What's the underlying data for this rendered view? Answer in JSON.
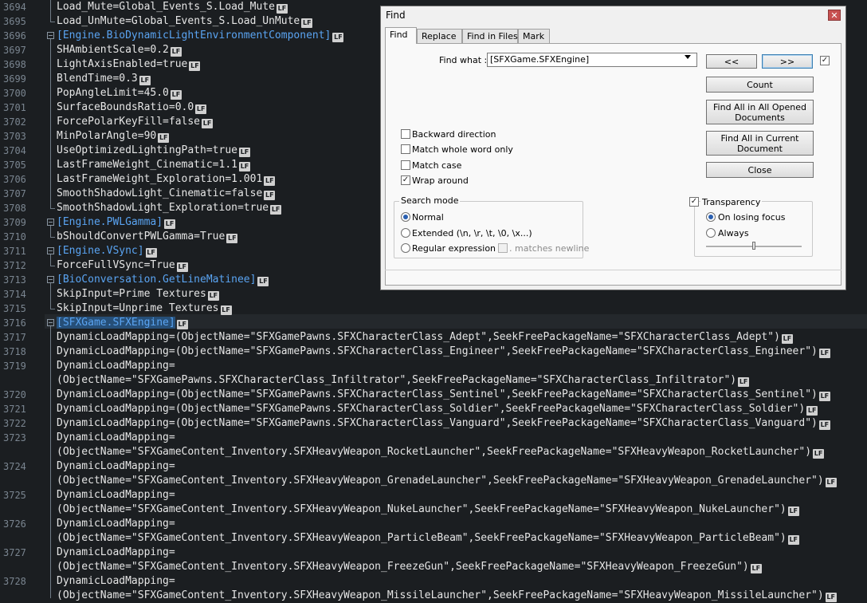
{
  "editor": {
    "lines": [
      {
        "n": "3694",
        "segs": [
          {
            "t": "Load_Mute",
            "c": "val"
          },
          {
            "t": "=",
            "c": "val"
          },
          {
            "t": "Global_Events_S.Load_Mute",
            "c": "val"
          }
        ],
        "lf": true
      },
      {
        "n": "3695",
        "segs": [
          {
            "t": "Load_UnMute",
            "c": "val"
          },
          {
            "t": "=",
            "c": "val"
          },
          {
            "t": "Global_Events_S.Load_UnMute",
            "c": "val"
          }
        ],
        "lf": true
      },
      {
        "n": "3696",
        "segs": [
          {
            "t": "[Engine.BioDynamicLightEnvironmentComponent]",
            "c": "sec"
          }
        ],
        "lf": true
      },
      {
        "n": "3697",
        "segs": [
          {
            "t": "SHAmbientScale=0.2",
            "c": "val"
          }
        ],
        "lf": true
      },
      {
        "n": "3698",
        "segs": [
          {
            "t": "LightAxisEnabled=true",
            "c": "val"
          }
        ],
        "lf": true
      },
      {
        "n": "3699",
        "segs": [
          {
            "t": "BlendTime=0.3",
            "c": "val"
          }
        ],
        "lf": true
      },
      {
        "n": "3700",
        "segs": [
          {
            "t": "PopAngleLimit=45.0",
            "c": "val"
          }
        ],
        "lf": true
      },
      {
        "n": "3701",
        "segs": [
          {
            "t": "SurfaceBoundsRatio=0.0",
            "c": "val"
          }
        ],
        "lf": true
      },
      {
        "n": "3702",
        "segs": [
          {
            "t": "ForcePolarKeyFill=false",
            "c": "val"
          }
        ],
        "lf": true
      },
      {
        "n": "3703",
        "segs": [
          {
            "t": "MinPolarAngle=90",
            "c": "val"
          }
        ],
        "lf": true
      },
      {
        "n": "3704",
        "segs": [
          {
            "t": "UseOptimizedLightingPath=true",
            "c": "val"
          }
        ],
        "lf": true
      },
      {
        "n": "3705",
        "segs": [
          {
            "t": "LastFrameWeight_Cinematic=1.1",
            "c": "val"
          }
        ],
        "lf": true
      },
      {
        "n": "3706",
        "segs": [
          {
            "t": "LastFrameWeight_Exploration=1.001",
            "c": "val"
          }
        ],
        "lf": true
      },
      {
        "n": "3707",
        "segs": [
          {
            "t": "SmoothShadowLight_Cinematic=false",
            "c": "val"
          }
        ],
        "lf": true
      },
      {
        "n": "3708",
        "segs": [
          {
            "t": "SmoothShadowLight_Exploration=true",
            "c": "val"
          }
        ],
        "lf": true
      },
      {
        "n": "3709",
        "segs": [
          {
            "t": "[Engine.PWLGamma]",
            "c": "sec"
          }
        ],
        "lf": true
      },
      {
        "n": "3710",
        "segs": [
          {
            "t": "bShouldConvertPWLGamma=True",
            "c": "val"
          }
        ],
        "lf": true
      },
      {
        "n": "3711",
        "segs": [
          {
            "t": "[Engine.VSync]",
            "c": "sec"
          }
        ],
        "lf": true
      },
      {
        "n": "3712",
        "segs": [
          {
            "t": "ForceFullVSync=True",
            "c": "val"
          }
        ],
        "lf": true
      },
      {
        "n": "3713",
        "segs": [
          {
            "t": "[BioConversation.GetLineMatinee]",
            "c": "sec"
          }
        ],
        "lf": true
      },
      {
        "n": "3714",
        "segs": [
          {
            "t": "SkipInput=Prime Textures",
            "c": "val"
          }
        ],
        "lf": true
      },
      {
        "n": "3715",
        "segs": [
          {
            "t": "SkipInput=Unprime Textures",
            "c": "val"
          }
        ],
        "lf": true
      },
      {
        "n": "3716",
        "segs": [
          {
            "t": "[SFXGame.SFXEngine]",
            "c": "sel"
          }
        ],
        "lf": true
      },
      {
        "n": "3717",
        "segs": [
          {
            "t": "DynamicLoadMapping=(ObjectName=\"SFXGamePawns.SFXCharacterClass_Adept\",SeekFreePackageName=\"SFXCharacterClass_Adept\")",
            "c": "val"
          }
        ],
        "lf": true
      },
      {
        "n": "3718",
        "segs": [
          {
            "t": "DynamicLoadMapping=(ObjectName=\"SFXGamePawns.SFXCharacterClass_Engineer\",SeekFreePackageName=\"SFXCharacterClass_Engineer\")",
            "c": "val"
          }
        ],
        "lf": true
      },
      {
        "n": "3719",
        "segs": [
          {
            "t": "DynamicLoadMapping=",
            "c": "val"
          }
        ],
        "lf": false
      },
      {
        "n": "",
        "segs": [
          {
            "t": "(ObjectName=\"SFXGamePawns.SFXCharacterClass_Infiltrator\",SeekFreePackageName=\"SFXCharacterClass_Infiltrator\")",
            "c": "val"
          }
        ],
        "lf": true
      },
      {
        "n": "3720",
        "segs": [
          {
            "t": "DynamicLoadMapping=(ObjectName=\"SFXGamePawns.SFXCharacterClass_Sentinel\",SeekFreePackageName=\"SFXCharacterClass_Sentinel\")",
            "c": "val"
          }
        ],
        "lf": true
      },
      {
        "n": "3721",
        "segs": [
          {
            "t": "DynamicLoadMapping=(ObjectName=\"SFXGamePawns.SFXCharacterClass_Soldier\",SeekFreePackageName=\"SFXCharacterClass_Soldier\")",
            "c": "val"
          }
        ],
        "lf": true
      },
      {
        "n": "3722",
        "segs": [
          {
            "t": "DynamicLoadMapping=(ObjectName=\"SFXGamePawns.SFXCharacterClass_Vanguard\",SeekFreePackageName=\"SFXCharacterClass_Vanguard\")",
            "c": "val"
          }
        ],
        "lf": true
      },
      {
        "n": "3723",
        "segs": [
          {
            "t": "DynamicLoadMapping=",
            "c": "val"
          }
        ],
        "lf": false
      },
      {
        "n": "",
        "segs": [
          {
            "t": "(ObjectName=\"SFXGameContent_Inventory.SFXHeavyWeapon_RocketLauncher\",SeekFreePackageName=\"SFXHeavyWeapon_RocketLauncher\")",
            "c": "val"
          }
        ],
        "lf": true
      },
      {
        "n": "3724",
        "segs": [
          {
            "t": "DynamicLoadMapping=",
            "c": "val"
          }
        ],
        "lf": false
      },
      {
        "n": "",
        "segs": [
          {
            "t": "(ObjectName=\"SFXGameContent_Inventory.SFXHeavyWeapon_GrenadeLauncher\",SeekFreePackageName=\"SFXHeavyWeapon_GrenadeLauncher\")",
            "c": "val"
          }
        ],
        "lf": true
      },
      {
        "n": "3725",
        "segs": [
          {
            "t": "DynamicLoadMapping=",
            "c": "val"
          }
        ],
        "lf": false
      },
      {
        "n": "",
        "segs": [
          {
            "t": "(ObjectName=\"SFXGameContent_Inventory.SFXHeavyWeapon_NukeLauncher\",SeekFreePackageName=\"SFXHeavyWeapon_NukeLauncher\")",
            "c": "val"
          }
        ],
        "lf": true
      },
      {
        "n": "3726",
        "segs": [
          {
            "t": "DynamicLoadMapping=",
            "c": "val"
          }
        ],
        "lf": false
      },
      {
        "n": "",
        "segs": [
          {
            "t": "(ObjectName=\"SFXGameContent_Inventory.SFXHeavyWeapon_ParticleBeam\",SeekFreePackageName=\"SFXHeavyWeapon_ParticleBeam\")",
            "c": "val"
          }
        ],
        "lf": true
      },
      {
        "n": "3727",
        "segs": [
          {
            "t": "DynamicLoadMapping=",
            "c": "val"
          }
        ],
        "lf": false
      },
      {
        "n": "",
        "segs": [
          {
            "t": "(ObjectName=\"SFXGameContent_Inventory.SFXHeavyWeapon_FreezeGun\",SeekFreePackageName=\"SFXHeavyWeapon_FreezeGun\")",
            "c": "val"
          }
        ],
        "lf": true
      },
      {
        "n": "3728",
        "segs": [
          {
            "t": "DynamicLoadMapping=",
            "c": "val"
          }
        ],
        "lf": false
      },
      {
        "n": "",
        "segs": [
          {
            "t": "(ObjectName=\"SFXGameContent_Inventory.SFXHeavyWeapon_MissileLauncher\",SeekFreePackageName=\"SFXHeavyWeapon_MissileLauncher\")",
            "c": "val"
          }
        ],
        "lf": true
      }
    ],
    "eol_marker": "LF"
  },
  "find_dialog": {
    "title": "Find",
    "close_glyph": "✕",
    "tabs": [
      "Find",
      "Replace",
      "Find in Files",
      "Mark"
    ],
    "find_what_label": "Find what :",
    "find_what_value": "[SFXGame.SFXEngine]",
    "prev_label": "<<",
    "next_label": ">>",
    "count_label": "Count",
    "find_all_opened_label": "Find All in All Opened Documents",
    "find_all_current_label": "Find All in Current Document",
    "close_label": "Close",
    "options": {
      "backward": {
        "label": "Backward direction",
        "checked": false
      },
      "whole_word": {
        "label": "Match whole word only",
        "checked": false
      },
      "match_case": {
        "label": "Match case",
        "checked": false
      },
      "wrap_around": {
        "label": "Wrap around",
        "checked": true
      }
    },
    "search_mode": {
      "title": "Search mode",
      "normal": "Normal",
      "extended": "Extended (\\n, \\r, \\t, \\0, \\x...)",
      "regex": "Regular expression",
      "matches_newline": ". matches newline",
      "selected": "normal"
    },
    "transparency": {
      "label": "Transparency",
      "checked": true,
      "on_losing_focus": "On losing focus",
      "always": "Always",
      "selected": "on_losing_focus",
      "level": 0.5
    },
    "check_glyph": "✓"
  }
}
